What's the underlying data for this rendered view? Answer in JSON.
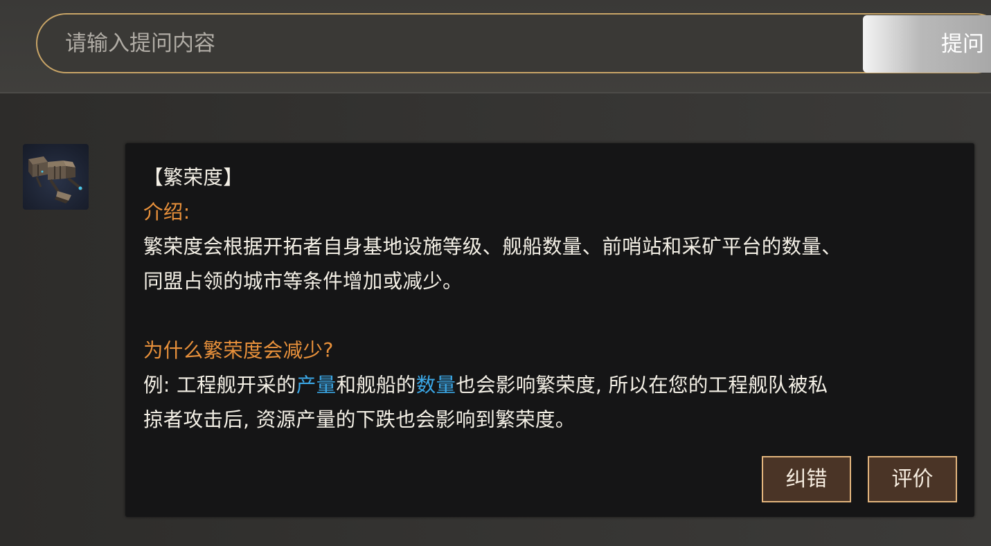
{
  "search": {
    "placeholder": "请输入提问内容",
    "value": "",
    "submit_label": "提问"
  },
  "answer": {
    "title": "【繁荣度】",
    "intro_heading": "介绍:",
    "intro_lines": [
      "繁荣度会根据开拓者自身基地设施等级、舰船数量、前哨站和采矿平台的数量、",
      "同盟占领的城市等条件增加或减少。"
    ],
    "why_heading": "为什么繁荣度会减少?",
    "example": {
      "prefix": "例: 工程舰开采的",
      "highlight_1": "产量",
      "middle": "和舰船的",
      "highlight_2": "数量",
      "suffix": "也会影响繁荣度, 所以在您的工程舰队被私",
      "line2": "掠者攻击后, 资源产量的下跌也会影响到繁荣度。"
    },
    "actions": {
      "correct_label": "纠错",
      "rate_label": "评价"
    }
  },
  "colors": {
    "accent_border": "#c9a567",
    "heading_orange": "#e9913b",
    "highlight_blue": "#3ba7e6",
    "button_fill": "#4a3426",
    "card_bg": "#151516"
  },
  "icons": {
    "avatar": "engineering-ship-icon"
  }
}
